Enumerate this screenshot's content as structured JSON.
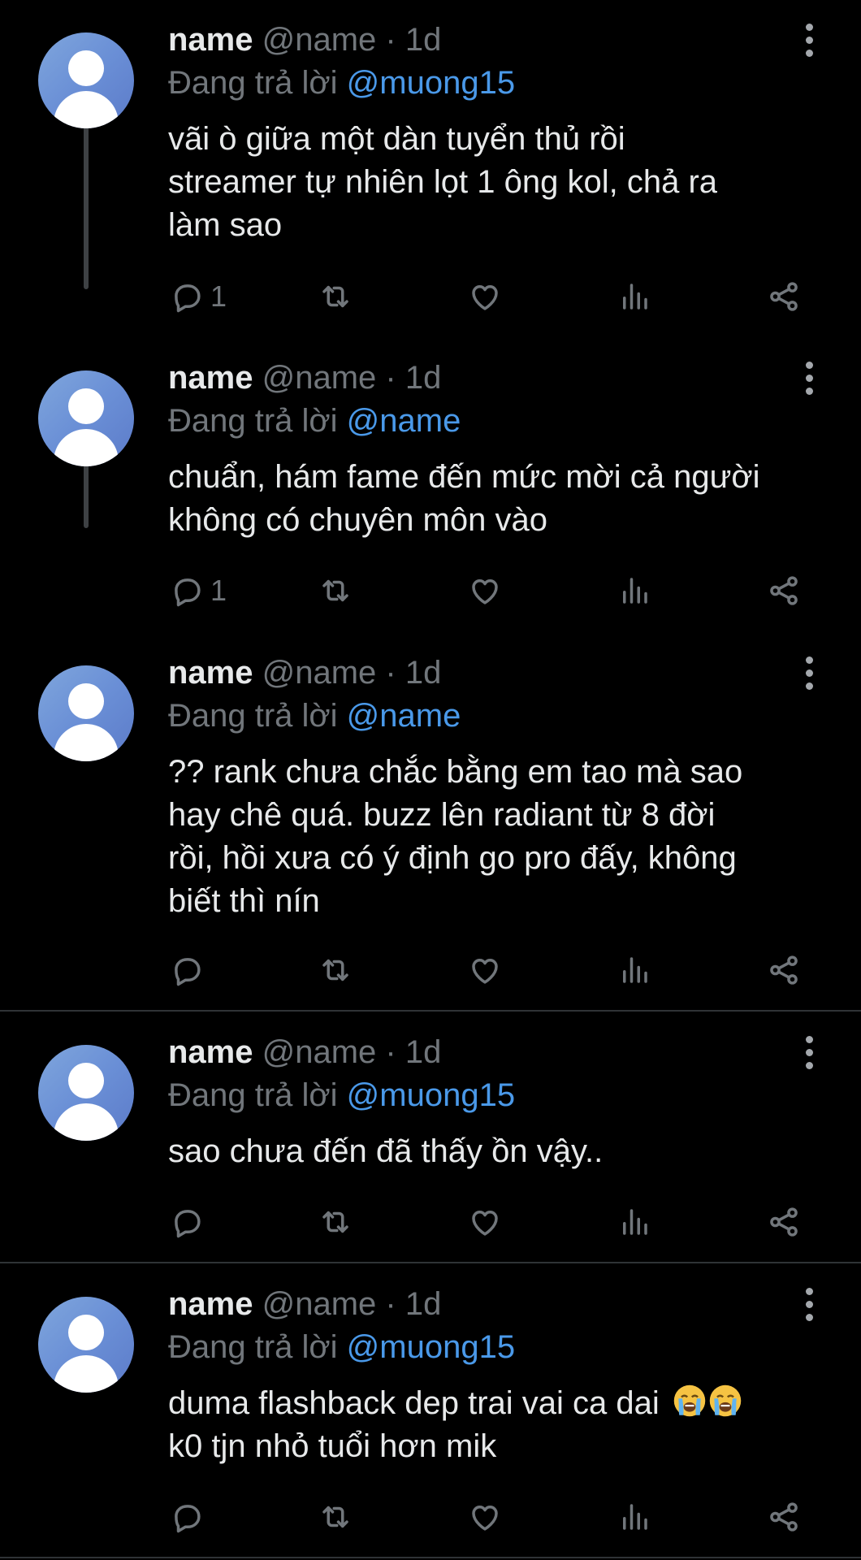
{
  "tweets": [
    {
      "name": "name",
      "handle_time": "@name · 1d",
      "reply_prefix": "Đang trả lời",
      "reply_to": "@muong15",
      "text_lines": [
        "vãi ò giữa một dàn tuyển thủ rồi",
        "streamer tự nhiên lọt 1 ông kol, chả ra",
        "làm sao"
      ],
      "reply_count": "1"
    },
    {
      "name": "name",
      "handle_time": "@name · 1d",
      "reply_prefix": "Đang trả lời",
      "reply_to": "@name",
      "text_lines": [
        "chuẩn, hám fame đến mức mời cả người",
        "không có chuyên môn vào"
      ],
      "reply_count": "1"
    },
    {
      "name": "name",
      "handle_time": "@name · 1d",
      "reply_prefix": "Đang trả lời",
      "reply_to": "@name",
      "text_lines": [
        "?? rank chưa chắc bằng em tao mà sao",
        "hay chê quá. buzz lên radiant từ 8 đời",
        "rồi, hồi xưa có ý định go pro đấy, không",
        "biết thì nín"
      ],
      "reply_count": ""
    },
    {
      "name": "name",
      "handle_time": "@name · 1d",
      "reply_prefix": "Đang trả lời",
      "reply_to": "@muong15",
      "text_lines": [
        "sao chưa đến đã thấy ồn vậy.."
      ],
      "reply_count": ""
    },
    {
      "name": "name",
      "handle_time": "@name · 1d",
      "reply_prefix": "Đang trả lời",
      "reply_to": "@muong15",
      "text_lines": [
        "duma flashback dep trai vai ca dai",
        "k0 tjn nhỏ tuổi hơn mik"
      ],
      "reply_count": "",
      "emoji": [
        "loudly-crying-face",
        "loudly-crying-face"
      ]
    }
  ],
  "icons": {
    "reply": "reply-icon",
    "retweet": "retweet-icon",
    "like": "heart-icon",
    "views": "analytics-icon",
    "share": "share-icon",
    "more": "more-options-icon"
  },
  "colors": {
    "background": "#000000",
    "text": "#e7e9ea",
    "secondary": "#71767b",
    "mention": "#4a99e9",
    "thread_line": "#3e4144",
    "separator": "#2f3336"
  }
}
